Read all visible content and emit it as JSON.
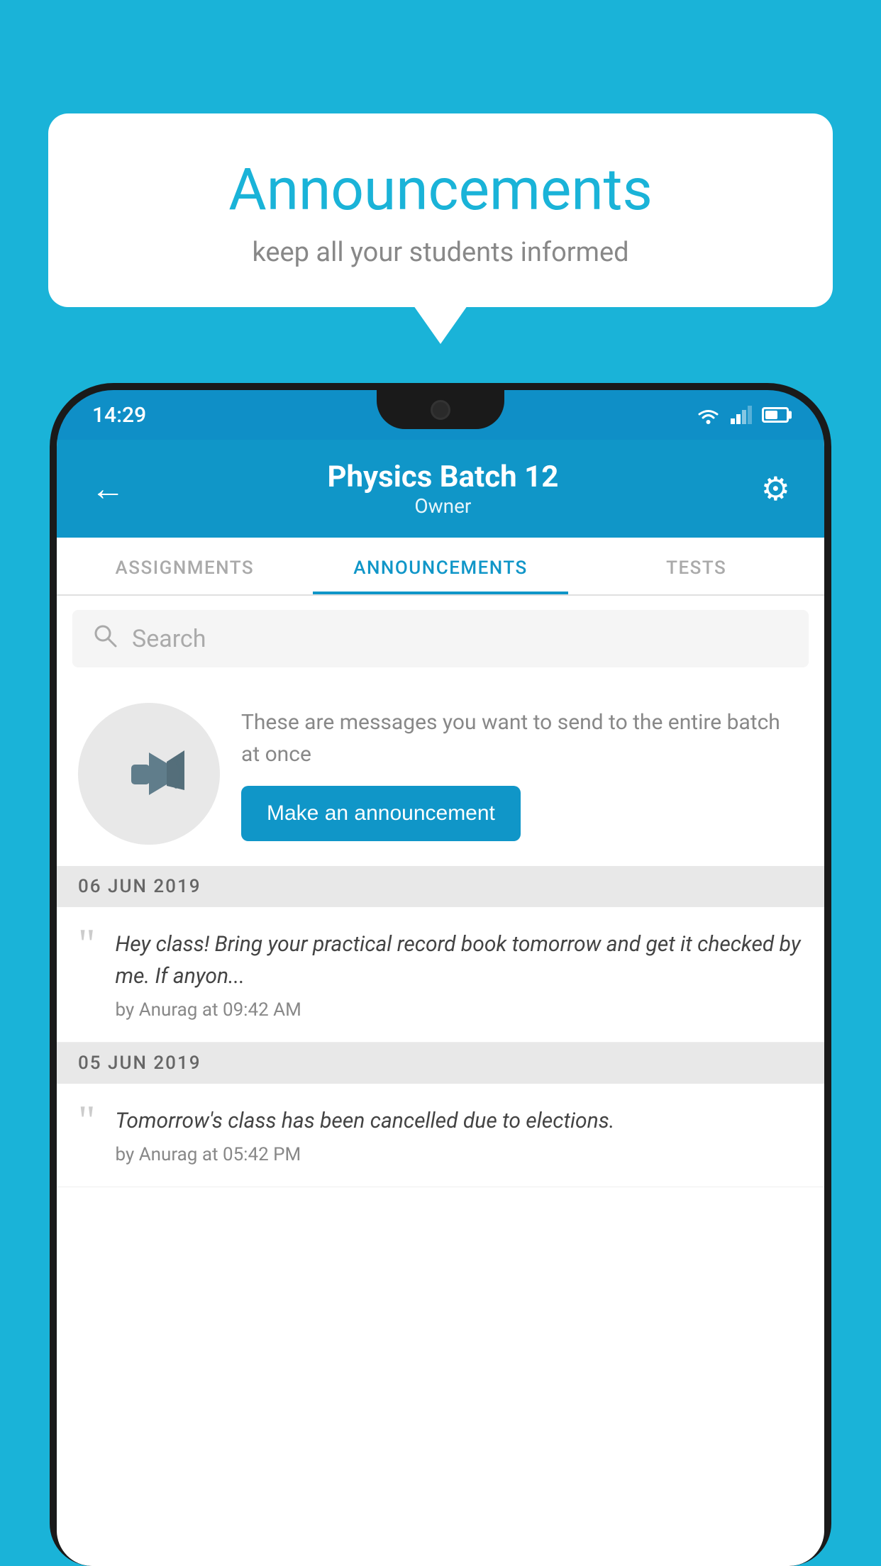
{
  "bubble": {
    "title": "Announcements",
    "subtitle": "keep all your students informed"
  },
  "status_bar": {
    "time": "14:29"
  },
  "app_bar": {
    "title": "Physics Batch 12",
    "subtitle": "Owner",
    "back_label": "←",
    "settings_label": "⚙"
  },
  "tabs": [
    {
      "label": "ASSIGNMENTS",
      "active": false
    },
    {
      "label": "ANNOUNCEMENTS",
      "active": true
    },
    {
      "label": "TESTS",
      "active": false
    }
  ],
  "search": {
    "placeholder": "Search"
  },
  "promo": {
    "text": "These are messages you want to send to the entire batch at once",
    "button_label": "Make an announcement"
  },
  "announcements": [
    {
      "date": "06  JUN  2019",
      "items": [
        {
          "text": "Hey class! Bring your practical record book tomorrow and get it checked by me. If anyon...",
          "meta": "by Anurag at 09:42 AM"
        }
      ]
    },
    {
      "date": "05  JUN  2019",
      "items": [
        {
          "text": "Tomorrow's class has been cancelled due to elections.",
          "meta": "by Anurag at 05:42 PM"
        }
      ]
    }
  ],
  "colors": {
    "accent": "#1096c8",
    "background": "#1ab3d8",
    "white": "#ffffff"
  }
}
